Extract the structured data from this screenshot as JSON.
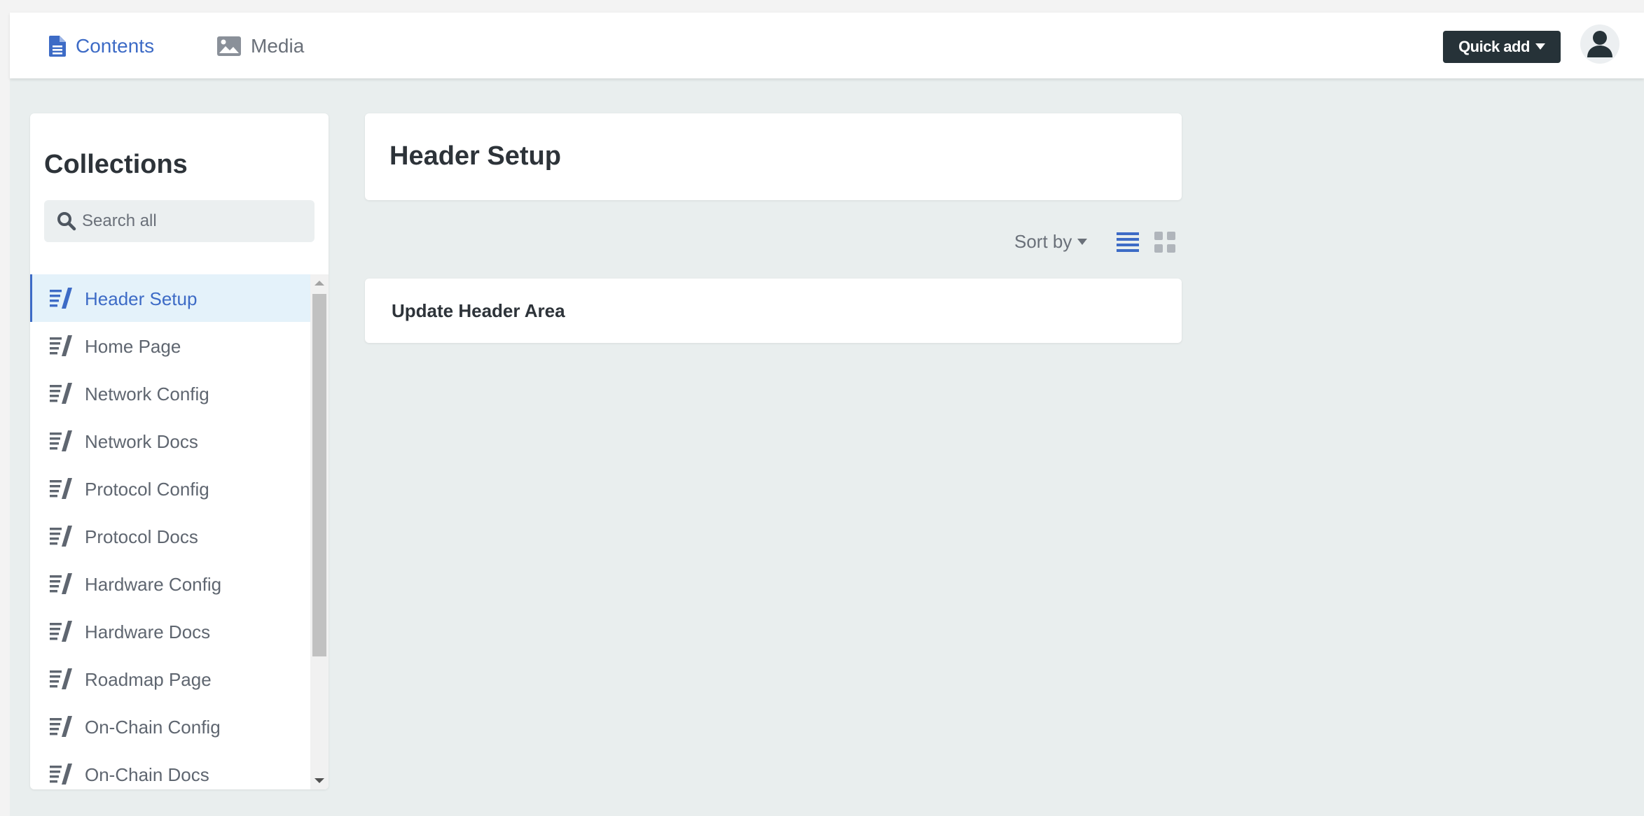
{
  "topbar": {
    "tabs": [
      {
        "label": "Contents",
        "icon": "file-icon",
        "active": true
      },
      {
        "label": "Media",
        "icon": "image-icon",
        "active": false
      }
    ],
    "quick_add_label": "Quick add",
    "avatar_icon": "user-avatar-icon"
  },
  "sidebar": {
    "title": "Collections",
    "search_placeholder": "Search all",
    "items": [
      {
        "label": "Header Setup",
        "active": true
      },
      {
        "label": "Home Page"
      },
      {
        "label": "Network Config"
      },
      {
        "label": "Network Docs"
      },
      {
        "label": "Protocol Config"
      },
      {
        "label": "Protocol Docs"
      },
      {
        "label": "Hardware Config"
      },
      {
        "label": "Hardware Docs"
      },
      {
        "label": "Roadmap Page"
      },
      {
        "label": "On-Chain Config"
      },
      {
        "label": "On-Chain Docs"
      }
    ]
  },
  "main": {
    "title": "Header Setup",
    "sort_label": "Sort by",
    "entries": [
      {
        "title": "Update Header Area"
      }
    ]
  },
  "colors": {
    "accent": "#3d6bc6",
    "dark_button": "#263238",
    "background": "#e9eeee",
    "active_item_bg": "#e4f2fa"
  }
}
